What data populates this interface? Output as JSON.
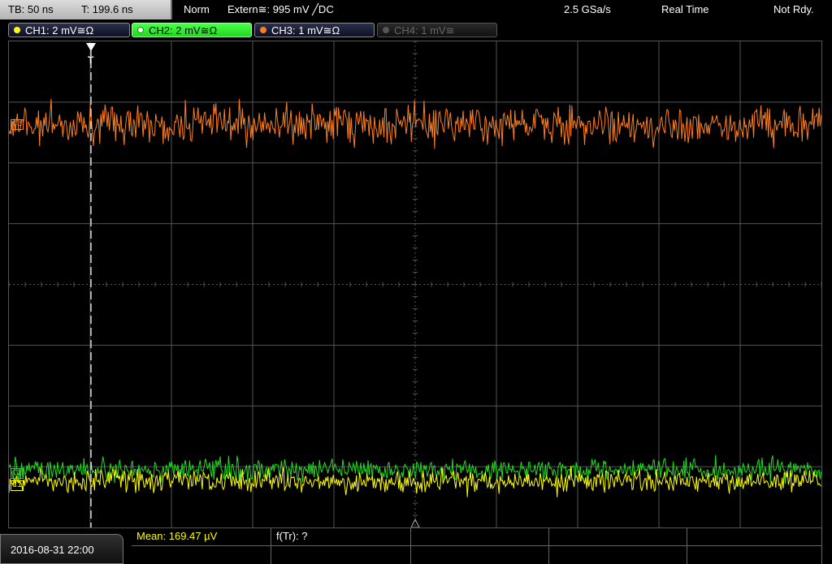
{
  "header": {
    "timebase": "TB: 50 ns",
    "trigger_time": "T: 199.6 ns",
    "mode": "Norm",
    "trigger_source": "Extern≅: 995 mV ╱DC",
    "sample_rate": "2.5 GSa/s",
    "acquisition": "Real Time",
    "status": "Not Rdy."
  },
  "channels": [
    {
      "label": "CH1: 2 mV≅Ω",
      "color": "#ffff00",
      "active": true
    },
    {
      "label": "CH2: 2 mV≅Ω",
      "color": "#22e022",
      "active": true,
      "selected": true
    },
    {
      "label": "CH3: 1 mV≅Ω",
      "color": "#ff7f1e",
      "active": true
    },
    {
      "label": "CH4: 1 mV≅",
      "color": "#555555",
      "active": false
    }
  ],
  "screen": {
    "trigger_marker": "T",
    "ch3_marker": "C3",
    "ch2_marker": "C2",
    "ch1_marker": "C1"
  },
  "footer": {
    "datetime": "2016-08-31 22:00",
    "measurements": [
      {
        "text": "Mean: 169.47 µV",
        "color": "#ffff00"
      },
      {
        "text": "f(Tr): ?",
        "color": "#ffffff"
      }
    ]
  },
  "colors": {
    "grid": "#555555",
    "ch1_trace": "#ffff00",
    "ch2_trace": "#22dd22",
    "ch3_trace": "#ff7f1e"
  }
}
